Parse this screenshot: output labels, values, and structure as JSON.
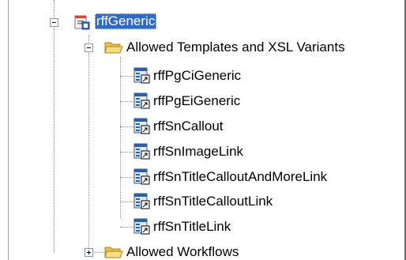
{
  "tree": {
    "root": {
      "label": "rffGeneric",
      "icon": "generic-object-icon",
      "expanded": true,
      "selected": true
    },
    "templates_folder": {
      "label": "Allowed Templates and XSL Variants",
      "icon": "open-folder-icon",
      "expanded": true,
      "items": [
        {
          "label": "rffPgCiGeneric",
          "icon": "template-shortcut-icon"
        },
        {
          "label": "rffPgEiGeneric",
          "icon": "template-shortcut-icon"
        },
        {
          "label": "rffSnCallout",
          "icon": "template-shortcut-icon"
        },
        {
          "label": "rffSnImageLink",
          "icon": "template-shortcut-icon"
        },
        {
          "label": "rffSnTitleCalloutAndMoreLink",
          "icon": "template-shortcut-icon"
        },
        {
          "label": "rffSnTitleCalloutLink",
          "icon": "template-shortcut-icon"
        },
        {
          "label": "rffSnTitleLink",
          "icon": "template-shortcut-icon"
        }
      ]
    },
    "workflows_folder": {
      "label": "Allowed Workflows",
      "icon": "closed-folder-icon",
      "expanded": false
    }
  },
  "colors": {
    "selection": "#316ac5",
    "folder": "#f5d96b",
    "expander_border": "#7f9db9"
  }
}
